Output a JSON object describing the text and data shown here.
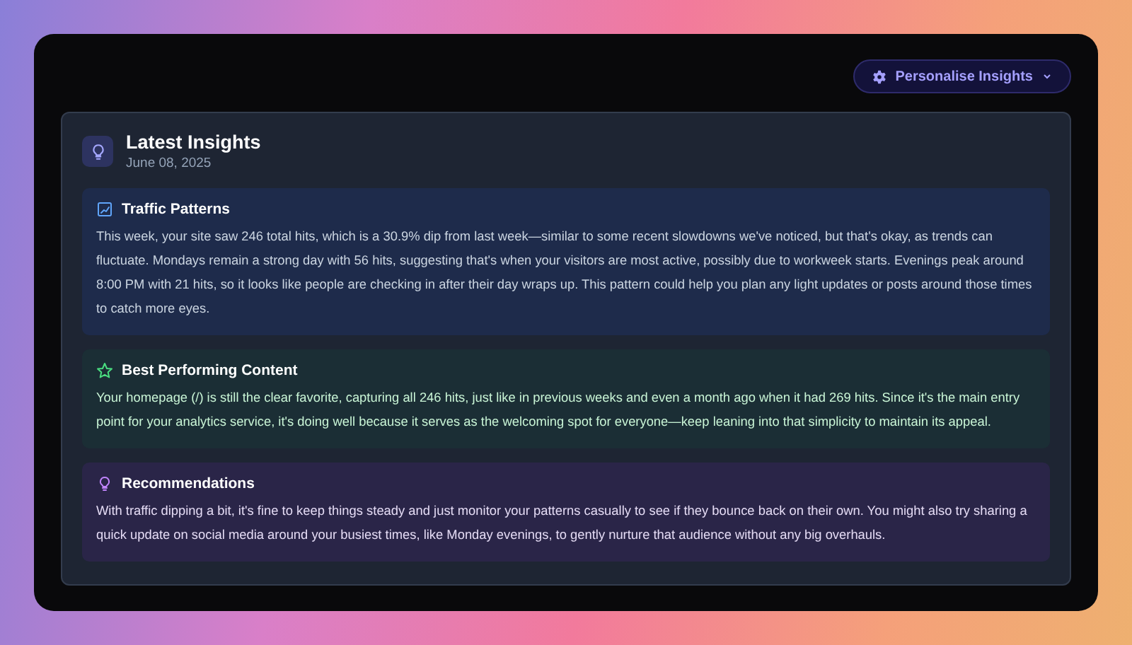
{
  "header": {
    "button": {
      "label": "Personalise Insights"
    }
  },
  "card": {
    "title": "Latest Insights",
    "date": "June 08, 2025",
    "sections": [
      {
        "kind": "traffic",
        "title": "Traffic Patterns",
        "text": "This week, your site saw 246 total hits, which is a 30.9% dip from last week—similar to some recent slowdowns we've noticed, but that's okay, as trends can fluctuate. Mondays remain a strong day with 56 hits, suggesting that's when your visitors are most active, possibly due to workweek starts. Evenings peak around 8:00 PM with 21 hits, so it looks like people are checking in after their day wraps up. This pattern could help you plan any light updates or posts around those times to catch more eyes."
      },
      {
        "kind": "content",
        "title": "Best Performing Content",
        "text": "Your homepage (/) is still the clear favorite, capturing all 246 hits, just like in previous weeks and even a month ago when it had 269 hits. Since it's the main entry point for your analytics service, it's doing well because it serves as the welcoming spot for everyone—keep leaning into that simplicity to maintain its appeal."
      },
      {
        "kind": "recommendations",
        "title": "Recommendations",
        "text": "With traffic dipping a bit, it's fine to keep things steady and just monitor your patterns casually to see if they bounce back on their own. You might also try sharing a quick update on social media around your busiest times, like Monday evenings, to gently nurture that audience without any big overhauls."
      }
    ]
  }
}
